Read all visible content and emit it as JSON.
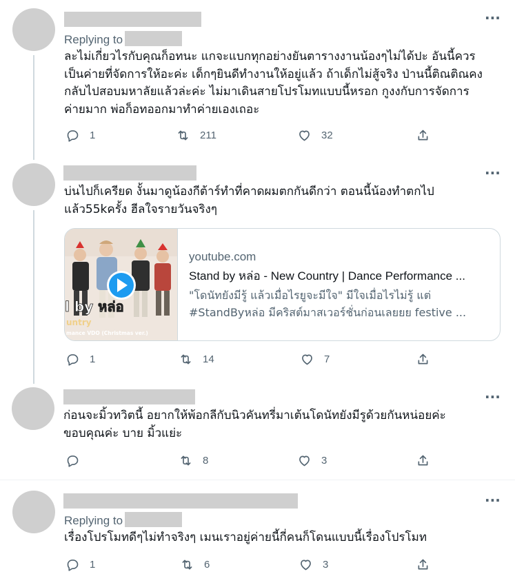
{
  "more_glyph": "···",
  "replying_label": "Replying to",
  "tweets": [
    {
      "lines": [
        "ละไม่เกี่ยวไรกับคุณก็อทนะ แกจะแบกทุกอย่างยันตารางงานน้องๆไม่ได้ปะ อันนี้ควร",
        "เป็นค่ายที่จัดการให้อะค่ะ เด็กๆยินดีทำงานให้อยู่แล้ว ถ้าเด็กไม่สู้จริง ป่านนี้ติณติณคง",
        "กลับไปสอบมหาลัยแล้วล่ะค่ะ ไม่มาเดินสายโปรโมทแบบนี้หรอก กูงงกับการจัดการ",
        "ค่ายมาก พ่อก็อทออกมาทำค่ายเองเถอะ"
      ],
      "replies": "1",
      "retweets": "211",
      "likes": "32"
    },
    {
      "lines": [
        "บ่นไปก็เครียด งั้นมาดูน้องกีต้าร์ทำที่คาดผมตกกันดีกว่า ตอนนี้น้องทำตกไป",
        "แล้ว55kครั้ง ฮีลใจรายวันจริงๆ"
      ],
      "card": {
        "domain": "youtube.com",
        "title": "Stand by หล่อ - New Country | Dance Performance ...",
        "desc_line1": "\"โดนัทยังมีรู้ แล้วเมื่อไรยูจะมีใจ\" มีใจเมื่อไรไม่รู้ แต่",
        "desc_line2": "#StandByหล่อ มีคริสต์มาสเวอร์ชั่นก่อนเลยยย festive ...",
        "thumb_text_big": "l by หล่อ",
        "thumb_text_mid": "untry",
        "thumb_text_small": "mance VDO (Christmas ver.)"
      },
      "replies": "1",
      "retweets": "14",
      "likes": "7"
    },
    {
      "lines": [
        "ก่อนจะมิ้วทวิตนี้ อยากให้พ้อกลีกับนิวคันทรี่มาเต้นโดนัทยังมีรูด้วยกันหน่อยค่ะ",
        "ขอบคุณค่ะ บาย มิ้วแย่ะ"
      ],
      "replies": "",
      "retweets": "8",
      "likes": "3"
    },
    {
      "lines": [
        "เรื่องโปรโมทดีๆไม่ทำจริงๆ เมนเราอยู่ค่ายนี้กี่คนก็โดนแบบนี้เรื่องโปรโมท"
      ],
      "replies": "1",
      "retweets": "6",
      "likes": "3"
    }
  ],
  "colors": {
    "text": "#0f1419",
    "muted": "#536471",
    "redaction": "#cfcfcf",
    "play_button": "#1d9bf0"
  }
}
